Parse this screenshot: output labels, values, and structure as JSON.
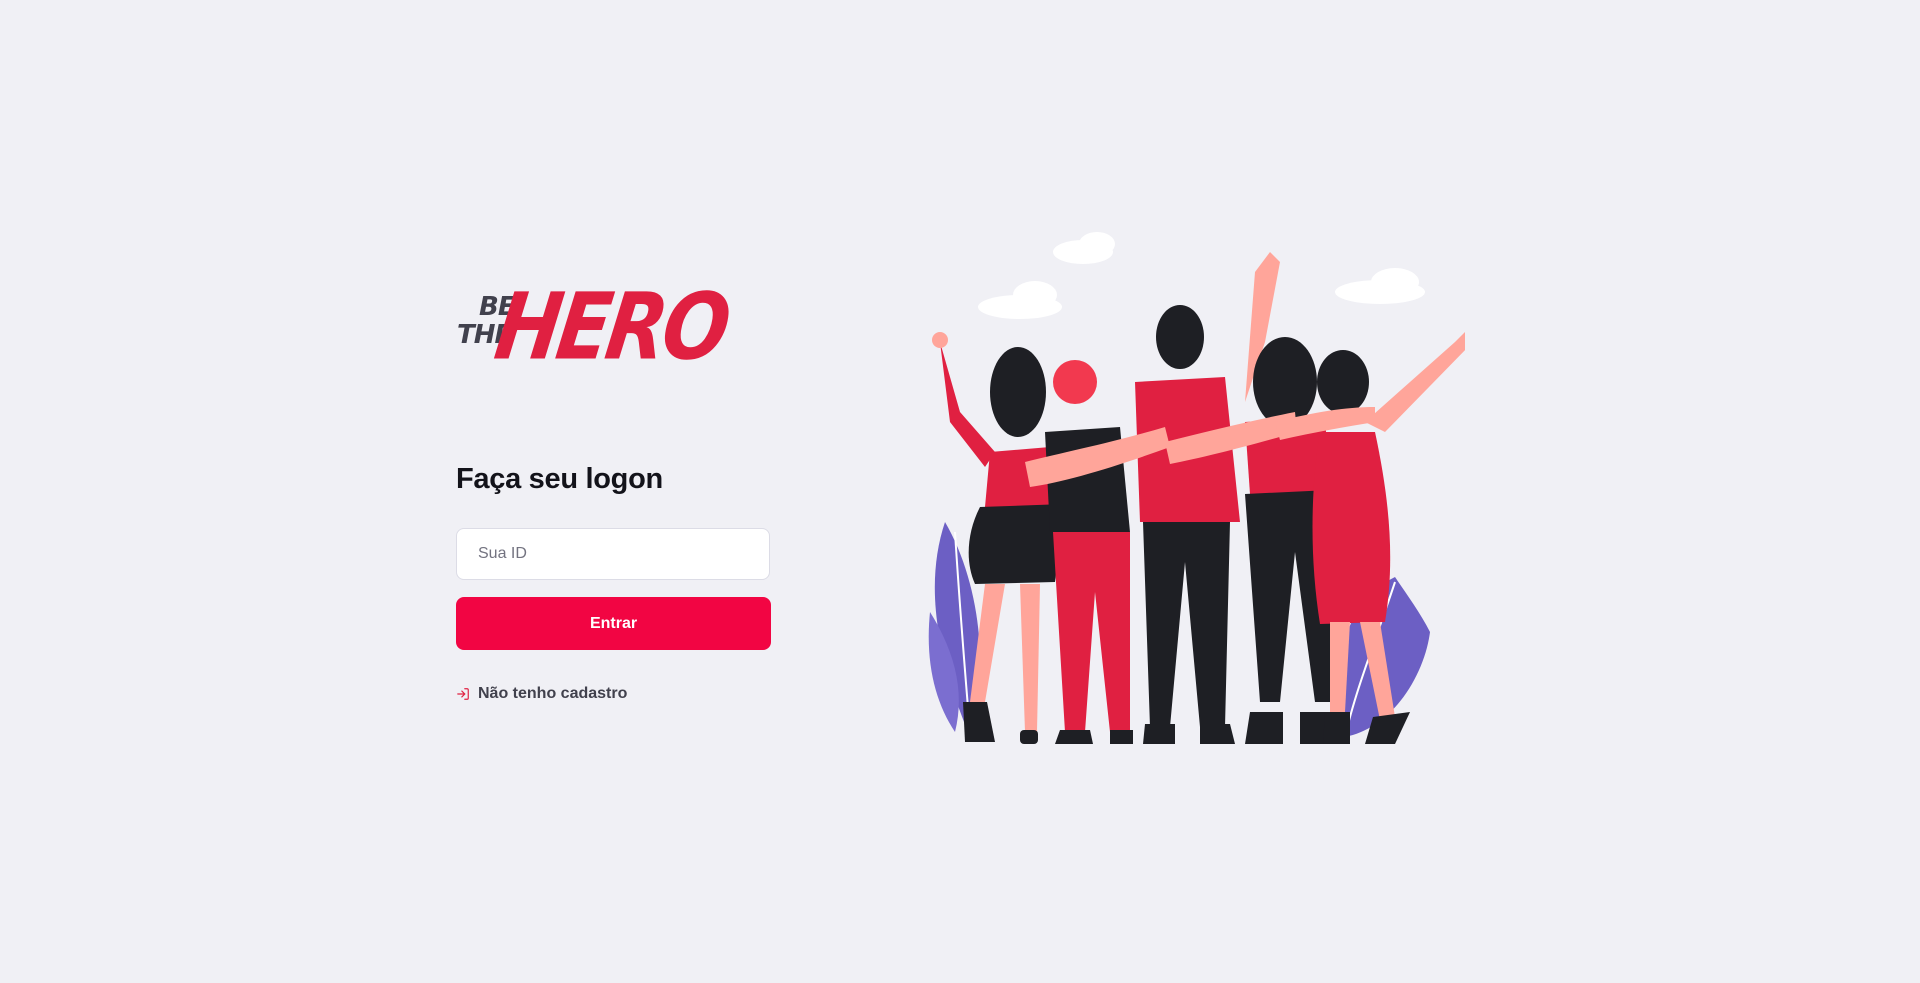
{
  "logo": {
    "be": "BE",
    "the": "THE",
    "hero": "HERO"
  },
  "form": {
    "title": "Faça seu logon",
    "id_placeholder": "Sua ID",
    "id_value": "",
    "submit_label": "Entrar",
    "register_label": "Não tenho cadastro",
    "register_icon": "log-in-icon"
  },
  "colors": {
    "accent": "#f20543",
    "brand_red": "#e02041",
    "background": "#f0f0f5",
    "text_dark": "#41414d"
  }
}
